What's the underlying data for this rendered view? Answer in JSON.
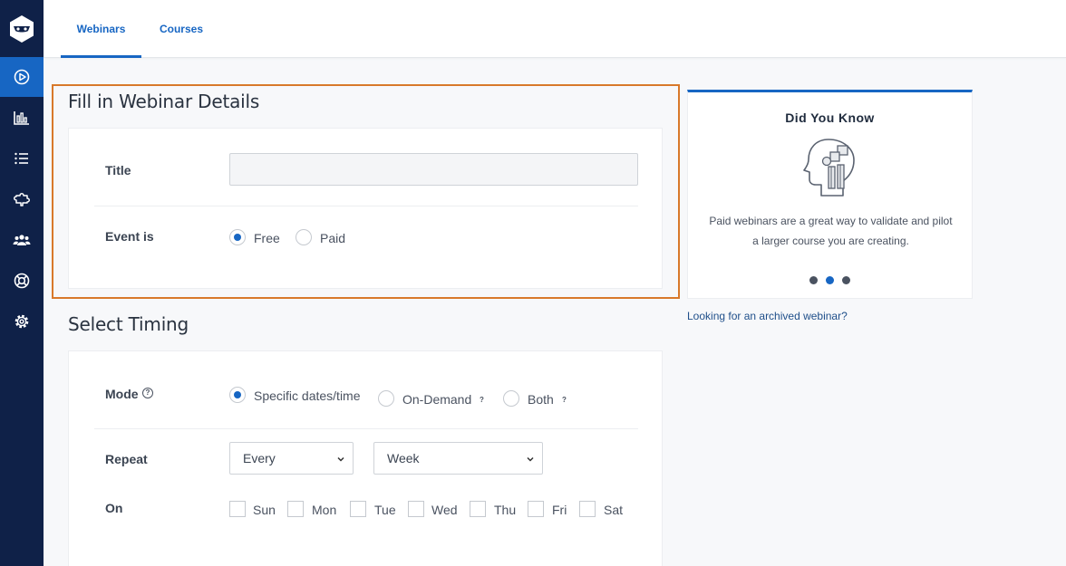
{
  "tabs": [
    {
      "label": "Webinars",
      "active": true
    },
    {
      "label": "Courses",
      "active": false
    }
  ],
  "sidebar": {
    "items": [
      {
        "icon": "play-circle-icon",
        "active": true
      },
      {
        "icon": "bar-chart-icon",
        "active": false
      },
      {
        "icon": "list-icon",
        "active": false
      },
      {
        "icon": "puzzle-icon",
        "active": false
      },
      {
        "icon": "users-icon",
        "active": false
      },
      {
        "icon": "lifebuoy-icon",
        "active": false
      },
      {
        "icon": "gear-icon",
        "active": false
      }
    ]
  },
  "details": {
    "heading": "Fill in Webinar Details",
    "title_label": "Title",
    "title_value": "",
    "event_label": "Event is",
    "event_options": [
      {
        "label": "Free",
        "checked": true
      },
      {
        "label": "Paid",
        "checked": false
      }
    ]
  },
  "timing": {
    "heading": "Select Timing",
    "mode_label": "Mode",
    "mode_help": "?",
    "mode_options": [
      {
        "label": "Specific dates/time",
        "checked": true
      },
      {
        "label": "On-Demand",
        "checked": false,
        "help": "?"
      },
      {
        "label": "Both",
        "checked": false,
        "help": "?"
      }
    ],
    "repeat_label": "Repeat",
    "repeat_every": "Every",
    "repeat_unit": "Week",
    "on_label": "On",
    "days": [
      {
        "label": "Sun",
        "checked": false
      },
      {
        "label": "Mon",
        "checked": false
      },
      {
        "label": "Tue",
        "checked": false
      },
      {
        "label": "Wed",
        "checked": false
      },
      {
        "label": "Thu",
        "checked": false
      },
      {
        "label": "Fri",
        "checked": false
      },
      {
        "label": "Sat",
        "checked": false
      }
    ]
  },
  "tip": {
    "title": "Did You Know",
    "text": "Paid webinars are a great way to validate and pilot a larger course you are creating.",
    "slide_count": 3,
    "active_slide": 2
  },
  "archived_link": "Looking for an archived webinar?",
  "colors": {
    "sidebar": "#0f2148",
    "accent": "#1766c3",
    "highlight": "#d8792a"
  }
}
